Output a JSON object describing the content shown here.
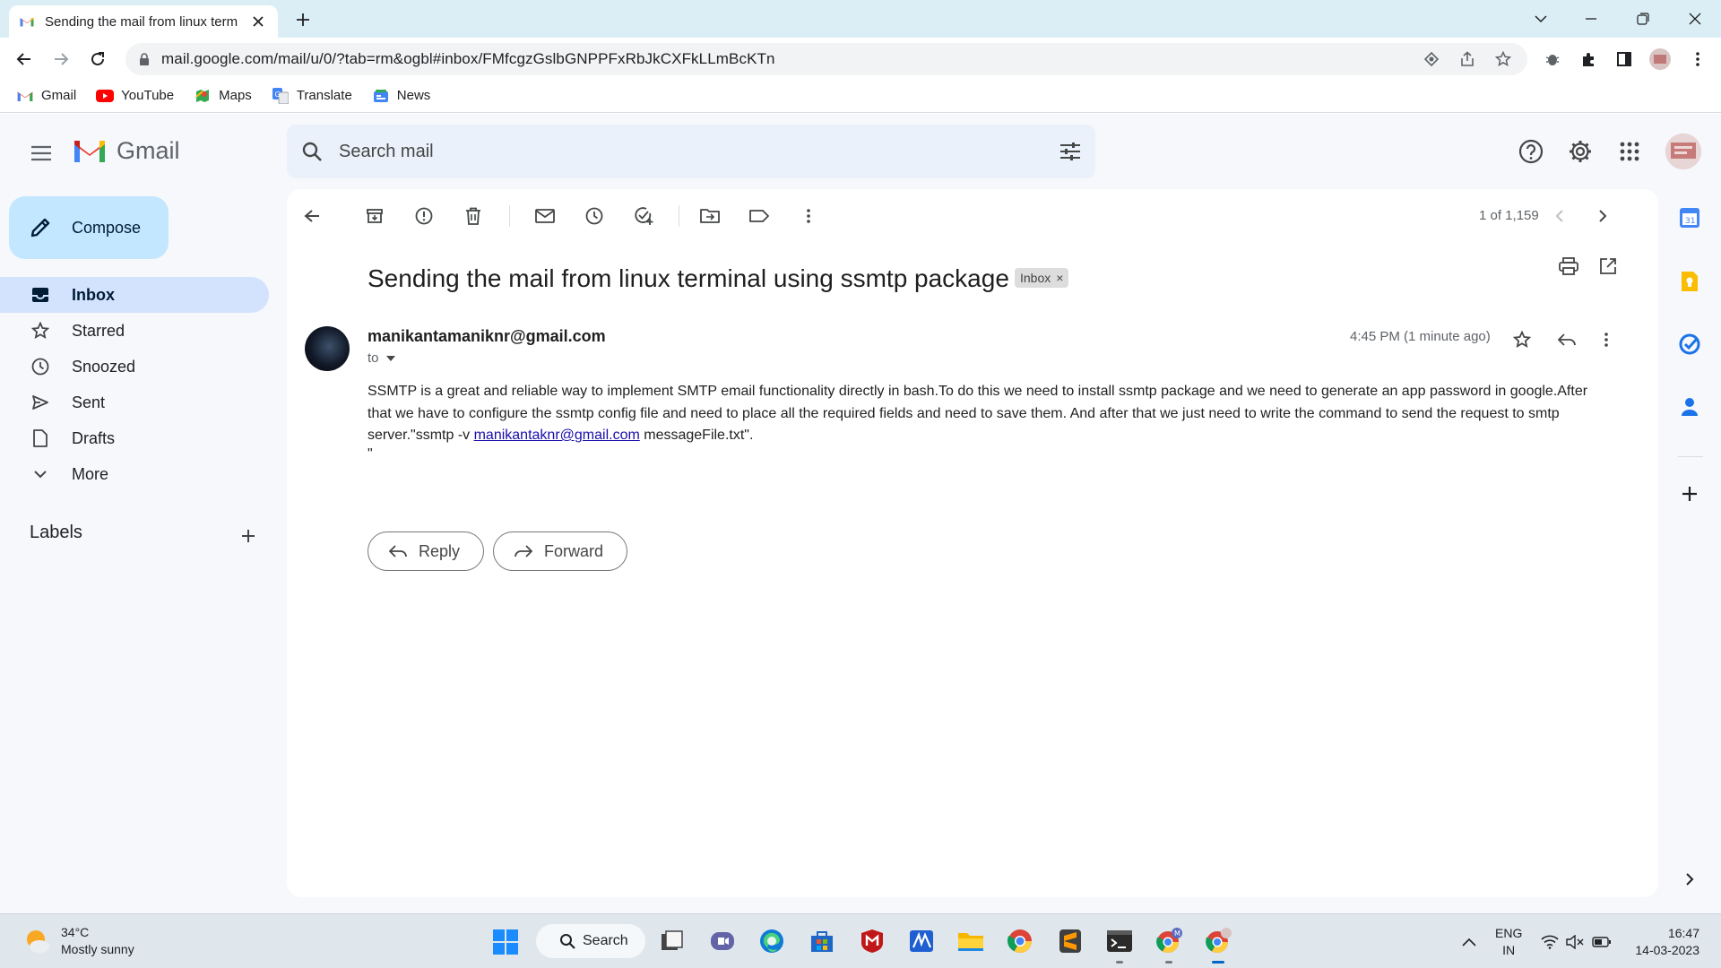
{
  "browser": {
    "tab_title": "Sending the mail from linux term",
    "url": "mail.google.com/mail/u/0/?tab=rm&ogbl#inbox/FMfcgzGslbGNPPFxRbJkCXFkLLmBcKTn",
    "bookmarks": [
      {
        "label": "Gmail",
        "icon": "gmail-icon"
      },
      {
        "label": "YouTube",
        "icon": "youtube-icon"
      },
      {
        "label": "Maps",
        "icon": "maps-icon"
      },
      {
        "label": "Translate",
        "icon": "translate-icon"
      },
      {
        "label": "News",
        "icon": "news-icon"
      }
    ]
  },
  "gmail": {
    "brand": "Gmail",
    "search_placeholder": "Search mail",
    "compose_label": "Compose",
    "nav": [
      {
        "label": "Inbox",
        "icon": "inbox-icon",
        "active": true
      },
      {
        "label": "Starred",
        "icon": "star-icon"
      },
      {
        "label": "Snoozed",
        "icon": "clock-icon"
      },
      {
        "label": "Sent",
        "icon": "send-icon"
      },
      {
        "label": "Drafts",
        "icon": "draft-icon"
      },
      {
        "label": "More",
        "icon": "chevron-down-icon"
      }
    ],
    "labels_header": "Labels",
    "pager": "1 of 1,159",
    "email": {
      "subject": "Sending the mail from linux terminal using ssmtp package",
      "label_chip": "Inbox",
      "label_chip_close": "×",
      "sender": "manikantamaniknr@gmail.com",
      "to": "to",
      "time": "4:45 PM (1 minute ago)",
      "body_part1": "SSMTP is a great and reliable way to implement SMTP email functionality directly in bash.To do this we need to install ssmtp package and we need to generate an app password in google.After that we have to configure the ssmtp config file and need to place all the required fields and need to save them. And after that we just need to write the command to send the request to smtp server.\"ssmtp -v ",
      "body_link": "manikantaknr@gmail.com",
      "body_part2": " messageFile.txt\".",
      "body_quote": "\"",
      "reply_label": "Reply",
      "forward_label": "Forward"
    }
  },
  "taskbar": {
    "temperature": "34°C",
    "weather": "Mostly sunny",
    "search_label": "Search",
    "lang_line1": "ENG",
    "lang_line2": "IN",
    "time": "16:47",
    "date": "14-03-2023"
  },
  "colors": {
    "accent": "#0b57d0",
    "compose_bg": "#c2e7ff",
    "active_nav": "#d3e3fd",
    "app_bg": "#f6f8fc",
    "tabstrip": "#dbeef5"
  }
}
